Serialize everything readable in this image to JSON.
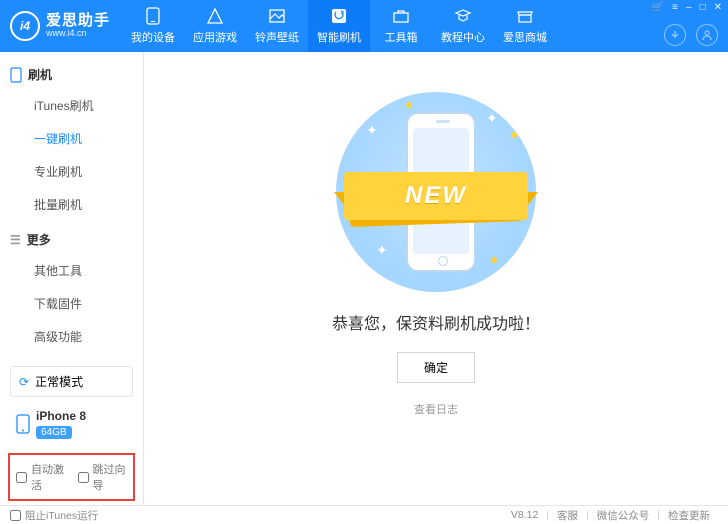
{
  "brand": {
    "name": "爱思助手",
    "url": "www.i4.cn",
    "logo_text": "i4"
  },
  "window_controls": {
    "cart": "🛒",
    "menu": "≡",
    "min": "–",
    "max": "□",
    "close": "✕"
  },
  "nav": [
    {
      "label": "我的设备"
    },
    {
      "label": "应用游戏"
    },
    {
      "label": "铃声壁纸"
    },
    {
      "label": "智能刷机",
      "active": true
    },
    {
      "label": "工具箱"
    },
    {
      "label": "教程中心"
    },
    {
      "label": "爱思商城"
    }
  ],
  "sidebar": {
    "sections": [
      {
        "title": "刷机",
        "icon": "phone",
        "items": [
          "iTunes刷机",
          "一键刷机",
          "专业刷机",
          "批量刷机"
        ],
        "active_item": "一键刷机"
      },
      {
        "title": "更多",
        "icon": "more",
        "items": [
          "其他工具",
          "下载固件",
          "高级功能"
        ]
      }
    ],
    "mode": {
      "icon": "refresh",
      "label": "正常模式"
    },
    "device": {
      "icon": "phone",
      "name": "iPhone 8",
      "storage": "64GB"
    },
    "opts": {
      "auto_activate": "自动激活",
      "skip_guide": "跳过向导"
    }
  },
  "main": {
    "ribbon": "NEW",
    "title": "恭喜您，保资料刷机成功啦！",
    "ok": "确定",
    "log": "查看日志"
  },
  "footer": {
    "block_itunes": "阻止iTunes运行",
    "version": "V8.12",
    "cs": "客服",
    "wechat": "微信公众号",
    "update": "检查更新"
  }
}
